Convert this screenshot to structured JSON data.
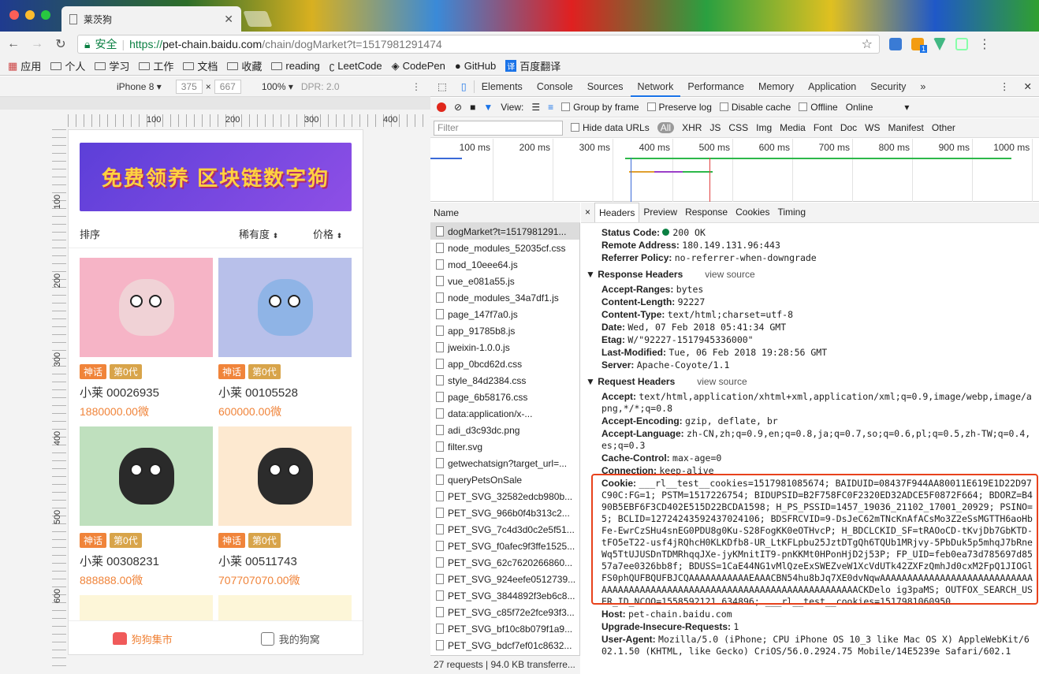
{
  "browser": {
    "tab_title": "莱茨狗",
    "secure_label": "安全",
    "url_scheme": "https://",
    "url_host": "pet-chain.baidu.com",
    "url_path": "/chain/dogMarket?t=1517981291474"
  },
  "bookmarks": [
    "应用",
    "个人",
    "学习",
    "工作",
    "文档",
    "收藏",
    "reading",
    "LeetCode",
    "CodePen",
    "GitHub",
    "百度翻译"
  ],
  "ext_badge": "1",
  "device": {
    "name": "iPhone 8",
    "width": "375",
    "height": "667",
    "zoom": "100%",
    "dpr": "DPR: 2.0"
  },
  "ruler_marks": [
    "100",
    "200",
    "300",
    "400"
  ],
  "ruler_v_marks": [
    "100",
    "200",
    "300",
    "400",
    "500",
    "600"
  ],
  "app": {
    "banner_text": "免费领养 区块链数字狗",
    "sort": {
      "a": "排序",
      "b": "稀有度",
      "c": "价格"
    },
    "cards": [
      {
        "tag1": "神话",
        "tag2": "第0代",
        "name": "小莱 00026935",
        "price": "1880000.00微",
        "bg": "#f6b4c6",
        "body": "#f0d2d6"
      },
      {
        "tag1": "神话",
        "tag2": "第0代",
        "name": "小莱 00105528",
        "price": "600000.00微",
        "bg": "#b8c0ea",
        "body": "#8fb4e6"
      },
      {
        "tag1": "神话",
        "tag2": "第0代",
        "name": "小莱 00308231",
        "price": "888888.00微",
        "bg": "#bfe0be",
        "body": "#2a2a2a"
      },
      {
        "tag1": "神话",
        "tag2": "第0代",
        "name": "小莱 00511743",
        "price": "707707070.00微",
        "bg": "#fde9d0",
        "body": "#2c2c2c"
      }
    ],
    "tabbar": {
      "market": "狗狗集市",
      "home": "我的狗窝"
    }
  },
  "devtools": {
    "tabs": [
      "Elements",
      "Console",
      "Sources",
      "Network",
      "Performance",
      "Memory",
      "Application",
      "Security",
      "»"
    ],
    "view_label": "View:",
    "group_by_frame": "Group by frame",
    "preserve_log": "Preserve log",
    "disable_cache": "Disable cache",
    "offline": "Offline",
    "online": "Online",
    "filter_placeholder": "Filter",
    "hide_data_urls": "Hide data URLs",
    "types": [
      "All",
      "XHR",
      "JS",
      "CSS",
      "Img",
      "Media",
      "Font",
      "Doc",
      "WS",
      "Manifest",
      "Other"
    ],
    "ticks": [
      "100 ms",
      "200 ms",
      "300 ms",
      "400 ms",
      "500 ms",
      "600 ms",
      "700 ms",
      "800 ms",
      "900 ms",
      "1000 ms"
    ],
    "list_header": "Name",
    "requests": [
      "dogMarket?t=1517981291...",
      "node_modules_52035cf.css",
      "mod_10eee64.js",
      "vue_e081a55.js",
      "node_modules_34a7df1.js",
      "page_147f7a0.js",
      "app_91785b8.js",
      "jweixin-1.0.0.js",
      "app_0bcd62d.css",
      "style_84d2384.css",
      "page_6b58176.css",
      "data:application/x-...",
      "adi_d3c93dc.png",
      "filter.svg",
      "getwechatsign?target_url=...",
      "queryPetsOnSale",
      "PET_SVG_32582edcb980b...",
      "PET_SVG_966b0f4b313c2...",
      "PET_SVG_7c4d3d0c2e5f51...",
      "PET_SVG_f0afec9f3ffe1525...",
      "PET_SVG_62c7620266860...",
      "PET_SVG_924eefe0512739...",
      "PET_SVG_3844892f3eb6c8...",
      "PET_SVG_c85f72e2fce93f3...",
      "PET_SVG_bf10c8b079f1a9...",
      "PET_SVG_bdcf7ef01c8632..."
    ],
    "footer": "27 requests | 94.0 KB transferre...",
    "detail_tabs": [
      "×",
      "Headers",
      "Preview",
      "Response",
      "Cookies",
      "Timing"
    ],
    "general": [
      {
        "k": "Status Code:",
        "v": "200 OK"
      },
      {
        "k": "Remote Address:",
        "v": "180.149.131.96:443"
      },
      {
        "k": "Referrer Policy:",
        "v": "no-referrer-when-downgrade"
      }
    ],
    "response_title": "Response Headers",
    "view_source": "view source",
    "response": [
      {
        "k": "Accept-Ranges:",
        "v": "bytes"
      },
      {
        "k": "Content-Length:",
        "v": "92227"
      },
      {
        "k": "Content-Type:",
        "v": "text/html;charset=utf-8"
      },
      {
        "k": "Date:",
        "v": "Wed, 07 Feb 2018 05:41:34 GMT"
      },
      {
        "k": "Etag:",
        "v": "W/\"92227-1517945336000\""
      },
      {
        "k": "Last-Modified:",
        "v": "Tue, 06 Feb 2018 19:28:56 GMT"
      },
      {
        "k": "Server:",
        "v": "Apache-Coyote/1.1"
      }
    ],
    "request_title": "Request Headers",
    "request": [
      {
        "k": "Accept:",
        "v": "text/html,application/xhtml+xml,application/xml;q=0.9,image/webp,image/apng,*/*;q=0.8"
      },
      {
        "k": "Accept-Encoding:",
        "v": "gzip, deflate, br"
      },
      {
        "k": "Accept-Language:",
        "v": "zh-CN,zh;q=0.9,en;q=0.8,ja;q=0.7,so;q=0.6,pl;q=0.5,zh-TW;q=0.4,es;q=0.3"
      },
      {
        "k": "Cache-Control:",
        "v": "max-age=0"
      },
      {
        "k": "Connection:",
        "v": "keep-alive"
      },
      {
        "k": "Cookie:",
        "v": "___rl__test__cookies=1517981085674; BAIDUID=08437F944AA80011E619E1D22D97C90C:FG=1; PSTM=1517226754; BIDUPSID=B2F758FC0F2320ED32ADCE5F0872F664; BDORZ=B490B5EBF6F3CD402E515D22BCDA1598; H_PS_PSSID=1457_19036_21102_17001_20929; PSINO=5; BCLID=12724243592437024106; BDSFRCVID=9-DsJeC62mTNcKnAfACsMo3Z2eSsMGTTH6aoHbFe-EwrCzSHu4snEG0PDU8g0Ku-S28FogKK0eOTHvcP; H_BDCLCKID_SF=tRAOoCD-tKvjDb7GbKTD-tFO5eT22-usf4jRQhcH0KLKDfb8-UR_LtKFLpbu25JztDTgQh6TQUb1MRjvy-5PbDuk5p5mhqJ7bRneWq5TtUJUSDnTDMRhqqJXe-jyKMnitIT9-pnKKMt0HPonHjD2j53P; FP_UID=feb0ea73d785697d8557a7ee0326bb8f; BDUSS=1CaE44NG1vMlQzeExSWEZveW1XcVdUTk42ZXFzQmhJd0cxM2FpQ1JIOGlFS0phQUFBQUFBJCQAAAAAAAAAAAEAAACBN54hu8bJq7XE0dvNqwAAAAAAAAAAAAAAAAAAAAAAAAAAAAAAAAAAAAAAAAAAAAAAAAAAAAAAAAAAAAAAAAAAAAAAAAAAACKDelo ig3paMS; OUTFOX_SEARCH_USER_ID_NCOO=1558592121.634896; ___rl__test__cookies=1517981060950"
      },
      {
        "k": "Host:",
        "v": "pet-chain.baidu.com"
      },
      {
        "k": "Upgrade-Insecure-Requests:",
        "v": "1"
      },
      {
        "k": "User-Agent:",
        "v": "Mozilla/5.0 (iPhone; CPU iPhone OS 10_3 like Mac OS X) AppleWebKit/602.1.50 (KHTML, like Gecko) CriOS/56.0.2924.75 Mobile/14E5239e Safari/602.1"
      }
    ]
  },
  "colors": {
    "accent": "#1a73e8",
    "price": "#f0843a",
    "highlight_box": "#e8421c",
    "status_ok": "#0b8043"
  }
}
